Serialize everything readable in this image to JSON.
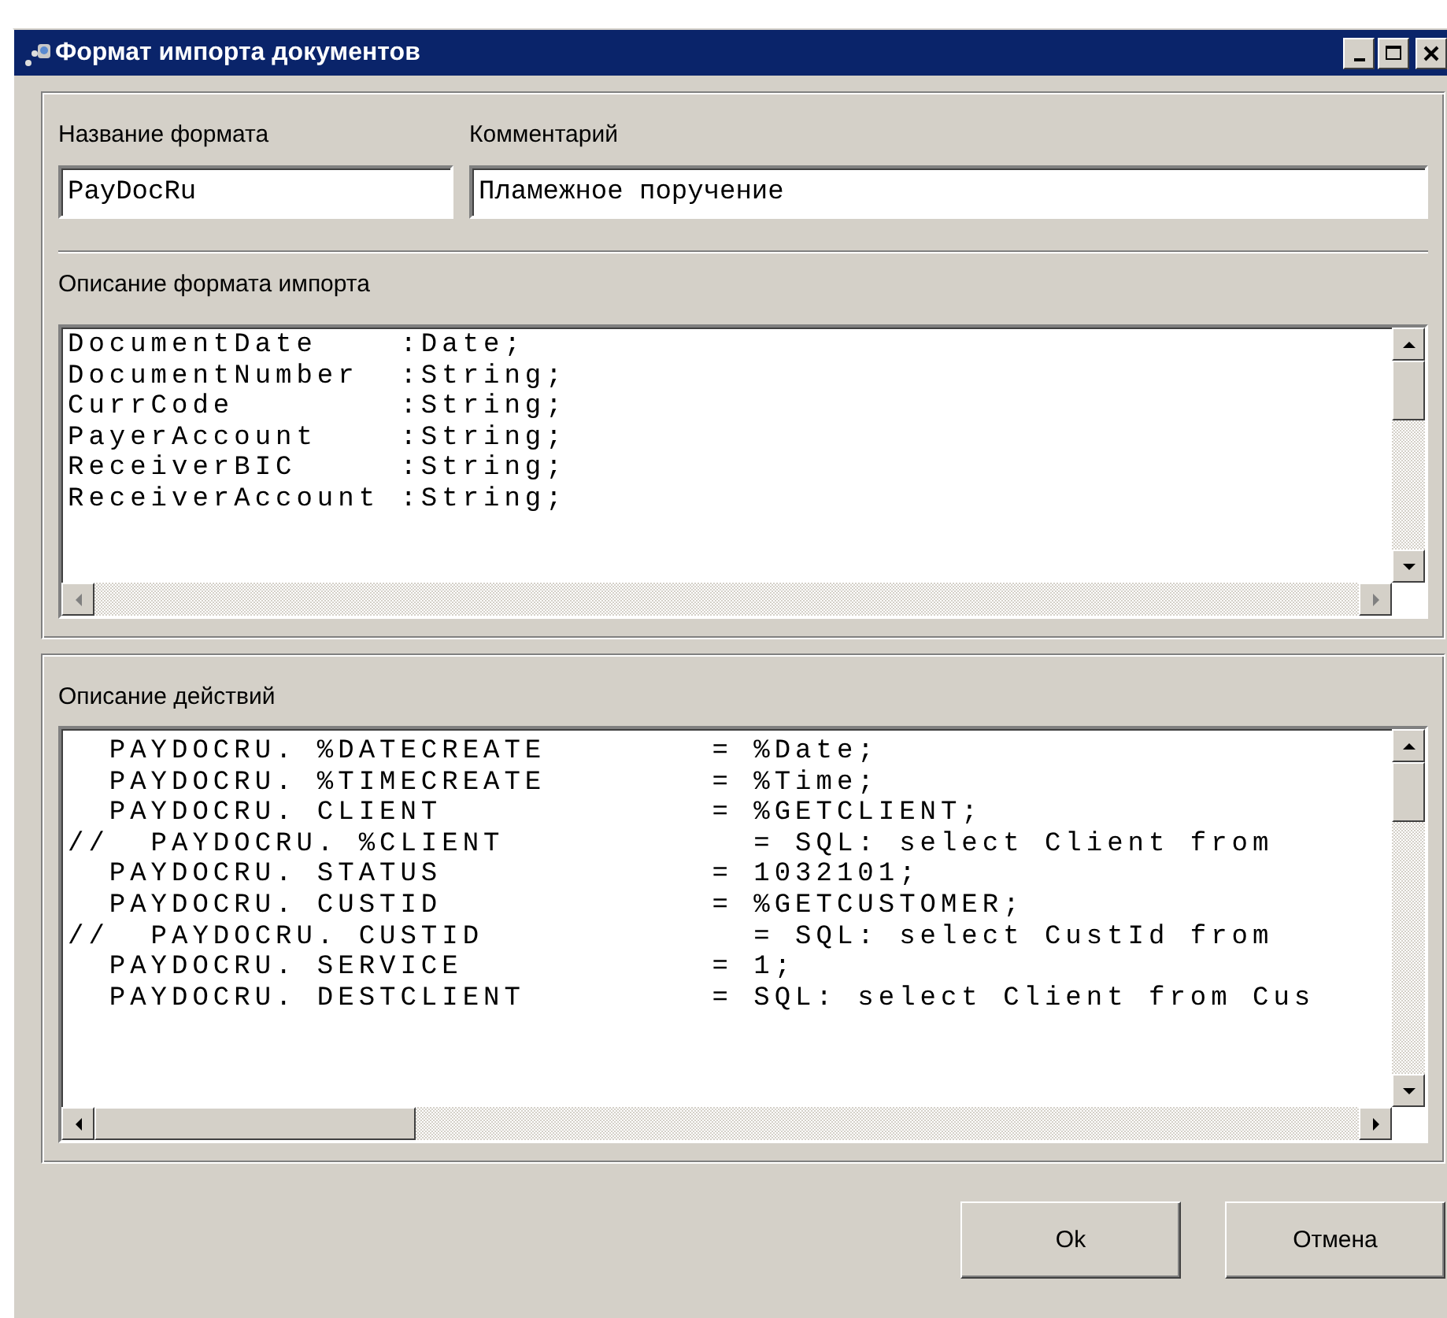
{
  "window": {
    "title": "Формат импорта документов"
  },
  "format_name": {
    "label": "Название формата",
    "value": "PayDocRu"
  },
  "comment": {
    "label": "Комментарий",
    "value": "Пламежное поручение"
  },
  "import_format": {
    "label": "Описание формата импорта",
    "lines": [
      "DocumentDate    :Date;",
      "DocumentNumber  :String;",
      "CurrCode        :String;",
      "PayerAccount    :String;",
      "ReceiverBIC     :String;",
      "ReceiverAccount :String;"
    ]
  },
  "actions": {
    "label": "Описание действий",
    "lines": [
      "  PAYDOCRU. %DATECREATE        = %Date;",
      "  PAYDOCRU. %TIMECREATE        = %Time;",
      "  PAYDOCRU. CLIENT             = %GETCLIENT;",
      "//  PAYDOCRU. %CLIENT            = SQL: select Client from",
      "  PAYDOCRU. STATUS             = 1032101;",
      "  PAYDOCRU. CUSTID             = %GETCUSTOMER;",
      "//  PAYDOCRU. CUSTID             = SQL: select CustId from",
      "  PAYDOCRU. SERVICE            = 1;",
      "  PAYDOCRU. DESTCLIENT         = SQL: select Client from Cus"
    ]
  },
  "buttons": [
    "Ok",
    "Отмена"
  ]
}
